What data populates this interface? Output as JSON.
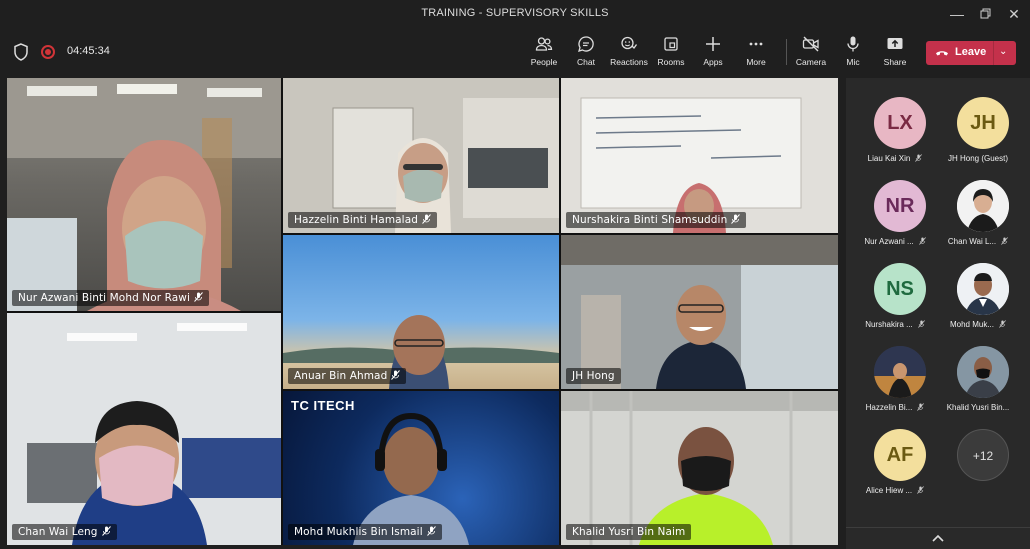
{
  "window": {
    "title": "TRAINING - SUPERVISORY SKILLS"
  },
  "meeting": {
    "timer": "04:45:34"
  },
  "toolbar": {
    "people": "People",
    "chat": "Chat",
    "reactions": "Reactions",
    "rooms": "Rooms",
    "apps": "Apps",
    "more": "More",
    "camera": "Camera",
    "mic": "Mic",
    "share": "Share",
    "leave": "Leave"
  },
  "video_tiles": [
    {
      "name": "Nur Azwani Binti Mohd Nor Rawi"
    },
    {
      "name": "Hazzelin Binti Hamalad"
    },
    {
      "name": "Nurshakira Binti Shamsuddin"
    },
    {
      "name": "Anuar Bin Ahmad"
    },
    {
      "name": "JH Hong"
    },
    {
      "name": "Chan Wai Leng"
    },
    {
      "name": "Mohd Mukhlis Bin Ismail"
    },
    {
      "name": "Khalid Yusri Bin Naim"
    }
  ],
  "tile_overlays": {
    "tcitech_logo": "TC ITECH"
  },
  "roster": [
    {
      "initials": "LX",
      "name": "Liau Kai Xin",
      "color": "#e8b7c4",
      "text": "#7a2a43"
    },
    {
      "initials": "JH",
      "name": "JH Hong (Guest)",
      "color": "#f3df9d",
      "text": "#6b5a12"
    },
    {
      "initials": "NR",
      "name": "Nur Azwani ...",
      "color": "#e2b9d4",
      "text": "#6a2a5a"
    },
    {
      "initials": "",
      "name": "Chan Wai L...",
      "color": "#8a8a8a",
      "text": "#fff"
    },
    {
      "initials": "NS",
      "name": "Nurshakira ...",
      "color": "#b7e3c9",
      "text": "#1f6a3f"
    },
    {
      "initials": "",
      "name": "Mohd Muk...",
      "color": "#8a8a8a",
      "text": "#fff"
    },
    {
      "initials": "",
      "name": "Hazzelin Bi...",
      "color": "#8a8a8a",
      "text": "#fff"
    },
    {
      "initials": "",
      "name": "Khalid Yusri Bin...",
      "color": "#8a8a8a",
      "text": "#fff"
    },
    {
      "initials": "AF",
      "name": "Alice Hiew ...",
      "color": "#f3df9d",
      "text": "#6b5a12"
    },
    {
      "initials": "+12",
      "name": "",
      "color": "#3b3b3b",
      "text": "#e0e0e0"
    }
  ],
  "colors": {
    "leave": "#c4314b",
    "record": "#d13438",
    "panel": "#292929",
    "background": "#1f1f1f"
  }
}
